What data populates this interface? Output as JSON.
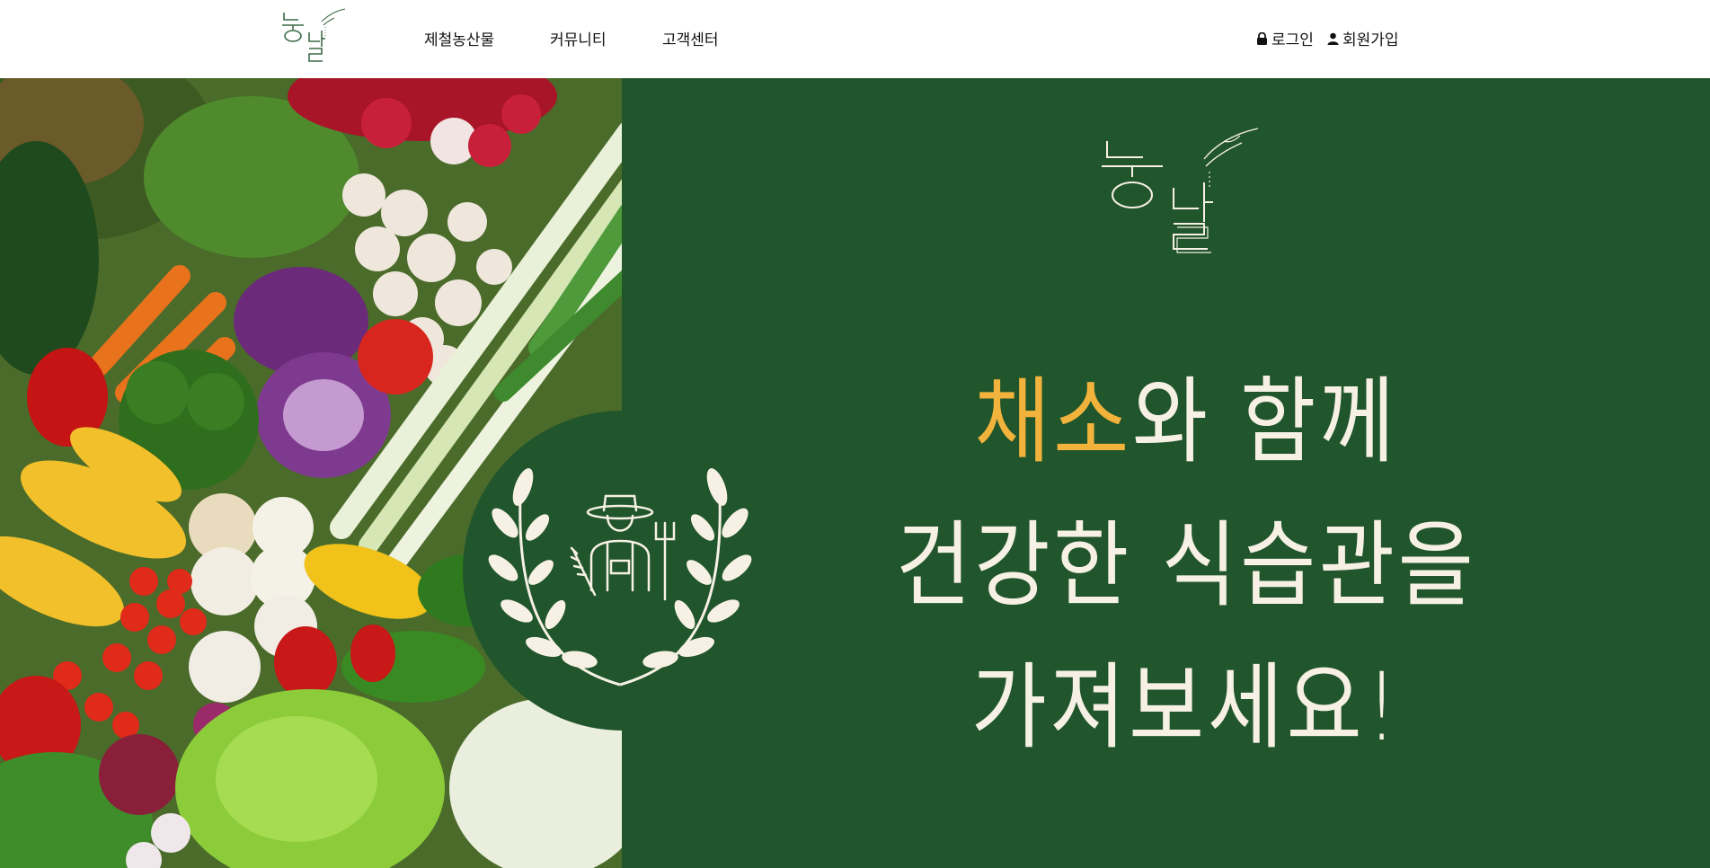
{
  "header": {
    "logo_text": "농달",
    "nav": [
      "제철농산물",
      "커뮤니티",
      "고객센터"
    ],
    "login_label": "로그인",
    "signup_label": "회원가입"
  },
  "hero": {
    "logo_text": "농달",
    "headline_line1_accent": "채소",
    "headline_line1_rest": "와 함께",
    "headline_line2": "건강한 식습관을",
    "headline_line3": "가져보세요!"
  },
  "colors": {
    "hero_bg": "#21552c",
    "accent": "#f2b33d",
    "headline_text": "#f6f1e4"
  },
  "icons": [
    "lock-icon",
    "user-icon",
    "laurel-farmer-icon",
    "vegetable-photo"
  ]
}
